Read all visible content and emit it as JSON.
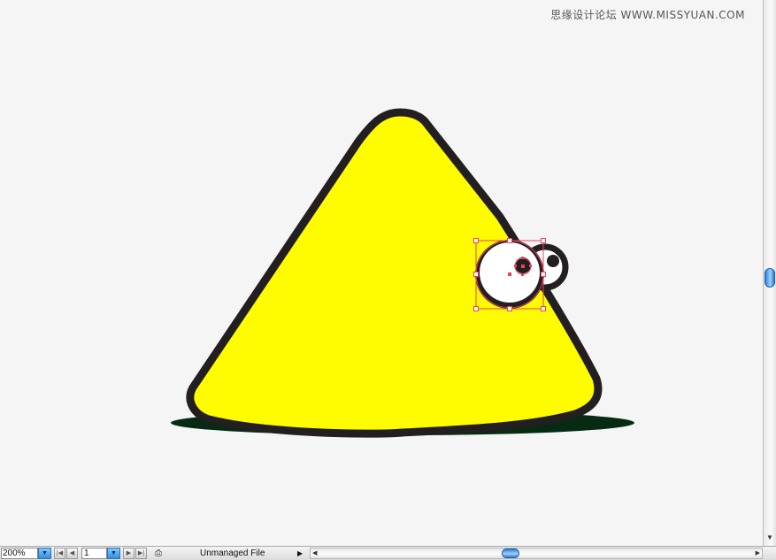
{
  "watermark": "思缘设计论坛  WWW.MISSYUAN.COM",
  "colors": {
    "body_fill": "#fffb00",
    "outline": "#231f20",
    "shadow": "#062b12",
    "eye_fill": "#ffffff",
    "selection": "#e8435a",
    "accent_blue": "#2f7fd8"
  },
  "statusbar": {
    "zoom": "200%",
    "page": "1",
    "status_text": "Unmanaged File"
  },
  "icons": {
    "zoom_dropdown": "triangle-down-icon",
    "first_page": "first-page-icon",
    "prev_page": "prev-page-icon",
    "next_page": "next-page-icon",
    "last_page": "last-page-icon",
    "page_dropdown": "triangle-down-icon",
    "print_tiling": "print-icon"
  }
}
